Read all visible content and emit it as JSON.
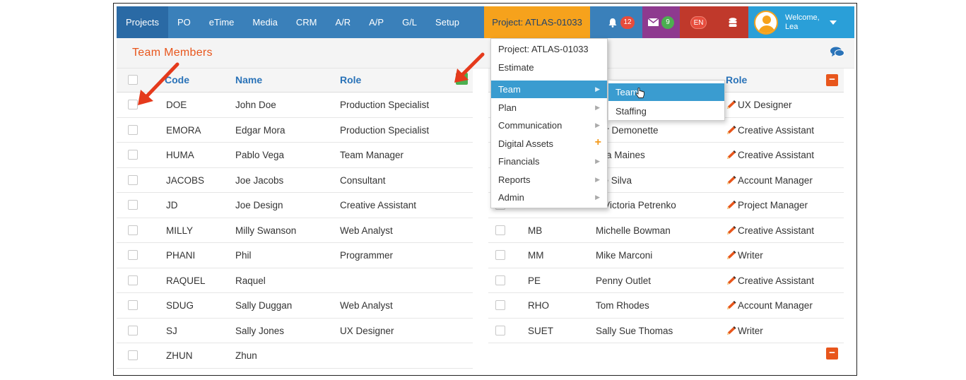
{
  "nav": {
    "items": [
      "Projects",
      "PO",
      "eTime",
      "Media",
      "CRM",
      "A/R",
      "A/P",
      "G/L",
      "Setup"
    ],
    "project_button": "Project: ATLAS-01033",
    "notifications_count": "12",
    "messages_count": "9",
    "language": "EN",
    "welcome_line1": "Welcome,",
    "welcome_line2": "Lea"
  },
  "colors": {
    "nav_bg": "#3a80ba",
    "project_button": "#f6a21c",
    "notif_box": "#c0392b",
    "msg_box": "#8e3a8f",
    "lang_box": "#c0392b",
    "db_box": "#c0392b",
    "user_box": "#2a9fd8",
    "title": "#e8561c",
    "add_button": "#4caf50",
    "remove_button": "#e8561c",
    "menu_highlight": "#3a9cd0"
  },
  "page": {
    "title": "Team Members"
  },
  "left_table": {
    "headers": {
      "code": "Code",
      "name": "Name",
      "role": "Role"
    },
    "rows": [
      {
        "code": "DOE",
        "name": "John Doe",
        "role": "Production Specialist"
      },
      {
        "code": "EMORA",
        "name": "Edgar Mora",
        "role": "Production Specialist"
      },
      {
        "code": "HUMA",
        "name": "Pablo Vega",
        "role": "Team Manager"
      },
      {
        "code": "JACOBS",
        "name": "Joe Jacobs",
        "role": "Consultant"
      },
      {
        "code": "JD",
        "name": "Joe Design",
        "role": "Creative Assistant"
      },
      {
        "code": "MILLY",
        "name": "Milly Swanson",
        "role": "Web Analyst"
      },
      {
        "code": "PHANI",
        "name": "Phil",
        "role": "Programmer"
      },
      {
        "code": "RAQUEL",
        "name": "Raquel",
        "role": ""
      },
      {
        "code": "SDUG",
        "name": "Sally Duggan",
        "role": "Web Analyst"
      },
      {
        "code": "SJ",
        "name": "Sally Jones",
        "role": "UX Designer"
      },
      {
        "code": "ZHUN",
        "name": "Zhun",
        "role": ""
      }
    ]
  },
  "right_table": {
    "headers": {
      "role": "Role"
    },
    "rows": [
      {
        "code": "",
        "name": "",
        "role": "UX Designer"
      },
      {
        "code": "",
        "name": "car Demonette",
        "role": "Creative Assistant"
      },
      {
        "code": "",
        "name": "nna Maines",
        "role": "Creative Assistant"
      },
      {
        "code": "",
        "name": "nie Silva",
        "role": "Account Manager"
      },
      {
        "code": "",
        "name": "a Victoria Petrenko",
        "role": "Project Manager"
      },
      {
        "code": "MB",
        "name": "Michelle Bowman",
        "role": "Creative Assistant"
      },
      {
        "code": "MM",
        "name": "Mike Marconi",
        "role": "Writer"
      },
      {
        "code": "PE",
        "name": "Penny Outlet",
        "role": "Creative Assistant"
      },
      {
        "code": "RHO",
        "name": "Tom Rhodes",
        "role": "Account Manager"
      },
      {
        "code": "SUET",
        "name": "Sally Sue Thomas",
        "role": "Writer"
      }
    ]
  },
  "menu": {
    "items": [
      {
        "label": "Project: ATLAS-01033",
        "arrow": "",
        "plus": ""
      },
      {
        "label": "Estimate",
        "arrow": "",
        "plus": ""
      },
      {
        "label": "Team",
        "arrow": "▶",
        "plus": ""
      },
      {
        "label": "Plan",
        "arrow": "▶",
        "plus": ""
      },
      {
        "label": "Communication",
        "arrow": "▶",
        "plus": ""
      },
      {
        "label": "Digital Assets",
        "arrow": "",
        "plus": "+"
      },
      {
        "label": "Financials",
        "arrow": "▶",
        "plus": ""
      },
      {
        "label": "Reports",
        "arrow": "▶",
        "plus": ""
      },
      {
        "label": "Admin",
        "arrow": "▶",
        "plus": ""
      }
    ],
    "highlighted_index": 2
  },
  "submenu": {
    "items": [
      "Team",
      "Staffing"
    ],
    "highlighted_index": 0
  },
  "icons": {
    "bell": "bell-icon",
    "envelope": "envelope-icon",
    "database": "database-icon",
    "chat": "chat-icon",
    "pencil": "pencil-icon",
    "hand": "hand-cursor-icon",
    "arrow": "red-arrow-annotation"
  }
}
